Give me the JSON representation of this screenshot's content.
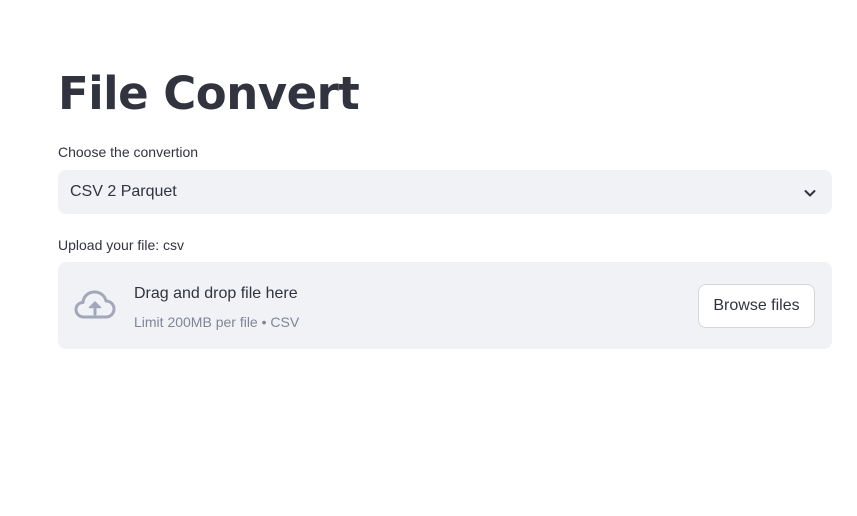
{
  "page": {
    "title": "File Convert"
  },
  "conversion_select": {
    "label": "Choose the convertion",
    "selected_value": "CSV 2 Parquet"
  },
  "uploader": {
    "label": "Upload your file: csv",
    "drop_text": "Drag and drop file here",
    "limit_text": "Limit 200MB per file • CSV",
    "browse_label": "Browse files"
  },
  "colors": {
    "text": "#31333f",
    "field_background": "#f0f2f6",
    "hint_text": "#808495",
    "cloud_icon": "#a3a8b8",
    "button_border": "#d6d6d9"
  },
  "icons": {
    "select_chevron": "chevron-down-icon",
    "upload": "cloud-upload-icon"
  }
}
